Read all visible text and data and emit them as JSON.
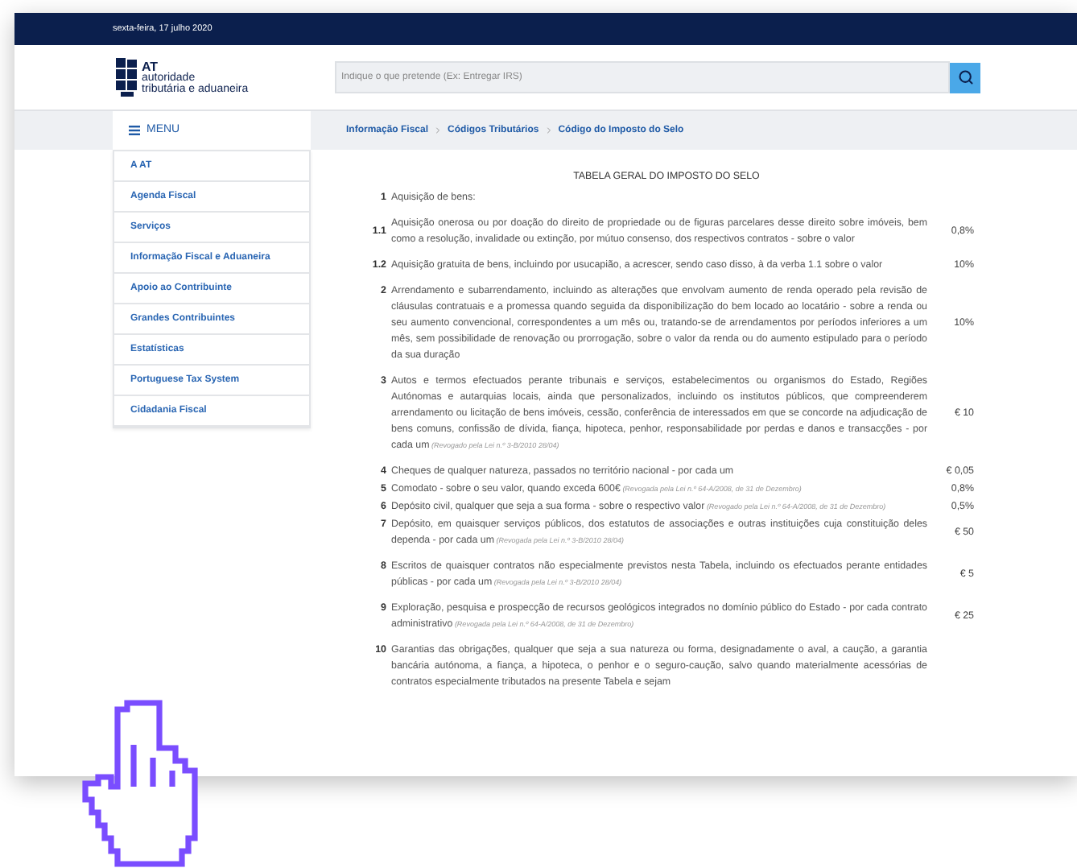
{
  "top_bar": {
    "date": "sexta-feira, 17 julho 2020"
  },
  "header": {
    "logo": {
      "short": "AT",
      "line1": "autoridade",
      "line2": "tributária e aduaneira"
    },
    "search": {
      "placeholder": "Indique o que pretende (Ex: Entregar IRS)"
    }
  },
  "menu_label": "MENU",
  "breadcrumb": [
    "Informação Fiscal",
    "Códigos Tributários",
    "Código do Imposto do Selo"
  ],
  "sidebar": {
    "items": [
      {
        "label": "A AT"
      },
      {
        "label": "Agenda Fiscal"
      },
      {
        "label": "Serviços"
      },
      {
        "label": "Informação Fiscal e Aduaneira"
      },
      {
        "label": "Apoio ao Contribuinte"
      },
      {
        "label": "Grandes Contribuintes"
      },
      {
        "label": "Estatísticas"
      },
      {
        "label": "Portuguese Tax System"
      },
      {
        "label": "Cidadania Fiscal"
      }
    ]
  },
  "document": {
    "title": "TABELA GERAL DO IMPOSTO DO SELO",
    "items": [
      {
        "kind": "main",
        "number": "1",
        "text": "Aquisição de bens:"
      },
      {
        "kind": "sub",
        "number": "1.1",
        "text": "Aquisição onerosa ou por doação do direito de propriedade ou de figuras parcelares desse direito sobre imóveis, bem como a resolução, invalidade ou extinção, por mútuo consenso, dos respectivos contratos - sobre o valor",
        "value": "0,8%"
      },
      {
        "kind": "sub",
        "number": "1.2",
        "text": "Aquisição gratuita de bens, incluindo por usucapião, a acrescer, sendo caso disso, à da verba 1.1 sobre o valor",
        "value": "10%"
      },
      {
        "kind": "main",
        "number": "2",
        "text": "Arrendamento e subarrendamento, incluindo as alterações que envolvam aumento de renda operado pela revisão de cláusulas contratuais e a promessa quando seguida da disponibilização do bem locado ao locatário - sobre a renda ou seu aumento convencional, correspondentes a um mês ou, tratando-se de arrendamentos por períodos inferiores a um mês, sem possibilidade de renovação ou prorrogação, sobre o valor da renda ou do aumento estipulado para o período da sua duração",
        "value": "10%"
      },
      {
        "kind": "main",
        "number": "3",
        "text": "Autos e termos efectuados perante tribunais e serviços, estabelecimentos ou organismos do Estado, Regiões Autónomas e autarquias locais, ainda que personalizados, incluindo os institutos públicos, que compreenderem arrendamento ou licitação de bens imóveis, cessão, conferência de interessados em que se concorde na adjudicação de bens comuns, confissão de dívida, fiança, hipoteca, penhor, responsabilidade por perdas e danos e transacções - por cada um",
        "note": "(Revogado pela Lei n.º 3-B/2010 28/04)",
        "value": "€ 10"
      },
      {
        "kind": "compact",
        "number": "4",
        "text": "Cheques de qualquer natureza, passados no território nacional - por cada um",
        "value": "€ 0,05"
      },
      {
        "kind": "compact",
        "number": "5",
        "text": "Comodato - sobre o seu valor, quando exceda 600€",
        "note": "(Revogada pela Lei n.º 64-A/2008, de 31 de Dezembro)",
        "value": "0,8%"
      },
      {
        "kind": "compact",
        "number": "6",
        "text": "Depósito civil, qualquer que seja a sua forma - sobre o respectivo valor",
        "note": "(Revogado pela Lei n.º 64-A/2008, de 31 de Dezembro)",
        "value": "0,5%"
      },
      {
        "kind": "main",
        "number": "7",
        "text": "Depósito, em quaisquer serviços públicos, dos estatutos de associações e outras instituições cuja constituição deles dependa - por cada um",
        "note": "(Revogada pela Lei n.º 3-B/2010 28/04)",
        "value": "€ 50"
      },
      {
        "kind": "main",
        "number": "8",
        "text": "Escritos de quaisquer contratos não especialmente previstos nesta Tabela, incluindo os efectuados perante entidades públicas - por cada um",
        "note": "(Revogada pela Lei n.º 3-B/2010 28/04)",
        "value": "€ 5"
      },
      {
        "kind": "main",
        "number": "9",
        "text": "Exploração, pesquisa e prospecção de recursos geológicos integrados no domínio público do Estado - por cada contrato administrativo",
        "note": "(Revogada pela Lei n.º 64-A/2008, de 31 de Dezembro)",
        "value": "€ 25"
      },
      {
        "kind": "main",
        "number": "10",
        "text": "Garantias das obrigações, qualquer que seja a sua natureza ou forma, designadamente o aval, a caução, a garantia bancária autónoma, a fiança, a hipoteca, o penhor e o seguro-caução, salvo quando materialmente acessórias de contratos especialmente tributados na presente Tabela e sejam"
      }
    ]
  }
}
